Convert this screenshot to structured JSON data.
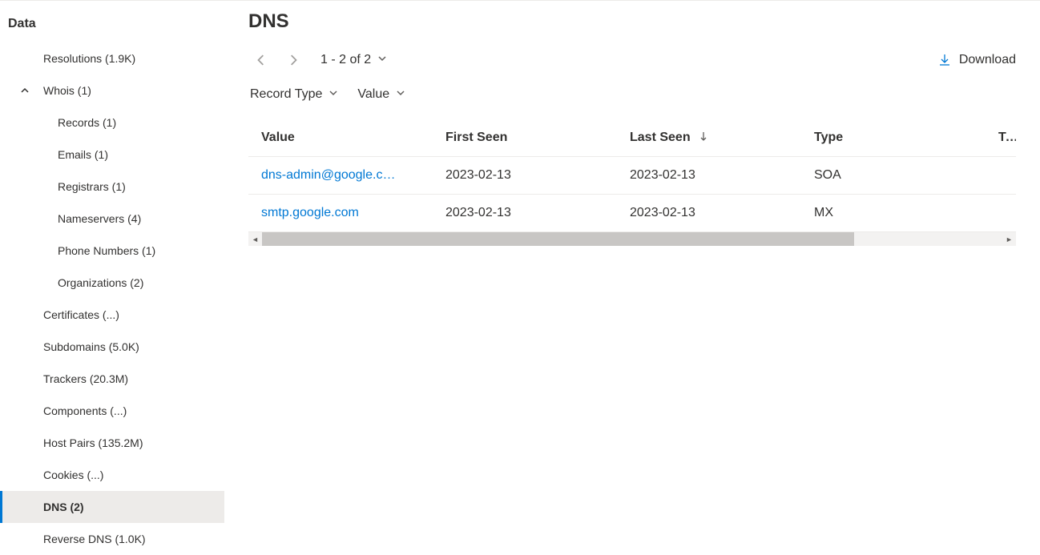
{
  "sidebar": {
    "title": "Data",
    "items": [
      {
        "label": "Resolutions (1.9K)",
        "level": 1
      },
      {
        "label": "Whois (1)",
        "level": 1,
        "expanded": true,
        "caret": true
      },
      {
        "label": "Records (1)",
        "level": 2
      },
      {
        "label": "Emails (1)",
        "level": 2
      },
      {
        "label": "Registrars (1)",
        "level": 2
      },
      {
        "label": "Nameservers (4)",
        "level": 2
      },
      {
        "label": "Phone Numbers (1)",
        "level": 2
      },
      {
        "label": "Organizations (2)",
        "level": 2
      },
      {
        "label": "Certificates (...)",
        "level": 1
      },
      {
        "label": "Subdomains (5.0K)",
        "level": 1
      },
      {
        "label": "Trackers (20.3M)",
        "level": 1
      },
      {
        "label": "Components (...)",
        "level": 1
      },
      {
        "label": "Host Pairs (135.2M)",
        "level": 1
      },
      {
        "label": "Cookies (...)",
        "level": 1
      },
      {
        "label": "DNS (2)",
        "level": 1,
        "selected": true
      },
      {
        "label": "Reverse DNS (1.0K)",
        "level": 1
      }
    ]
  },
  "main": {
    "title": "DNS",
    "pager": "1 - 2 of 2",
    "download": "Download",
    "filters": [
      {
        "label": "Record Type"
      },
      {
        "label": "Value"
      }
    ],
    "columns": {
      "value": "Value",
      "firstSeen": "First Seen",
      "lastSeen": "Last Seen",
      "type": "Type",
      "tags": "Tags"
    },
    "sortedColumn": "lastSeen",
    "rows": [
      {
        "value": "dns-admin@google.c…",
        "firstSeen": "2023-02-13",
        "lastSeen": "2023-02-13",
        "type": "SOA"
      },
      {
        "value": "smtp.google.com",
        "firstSeen": "2023-02-13",
        "lastSeen": "2023-02-13",
        "type": "MX"
      }
    ]
  }
}
